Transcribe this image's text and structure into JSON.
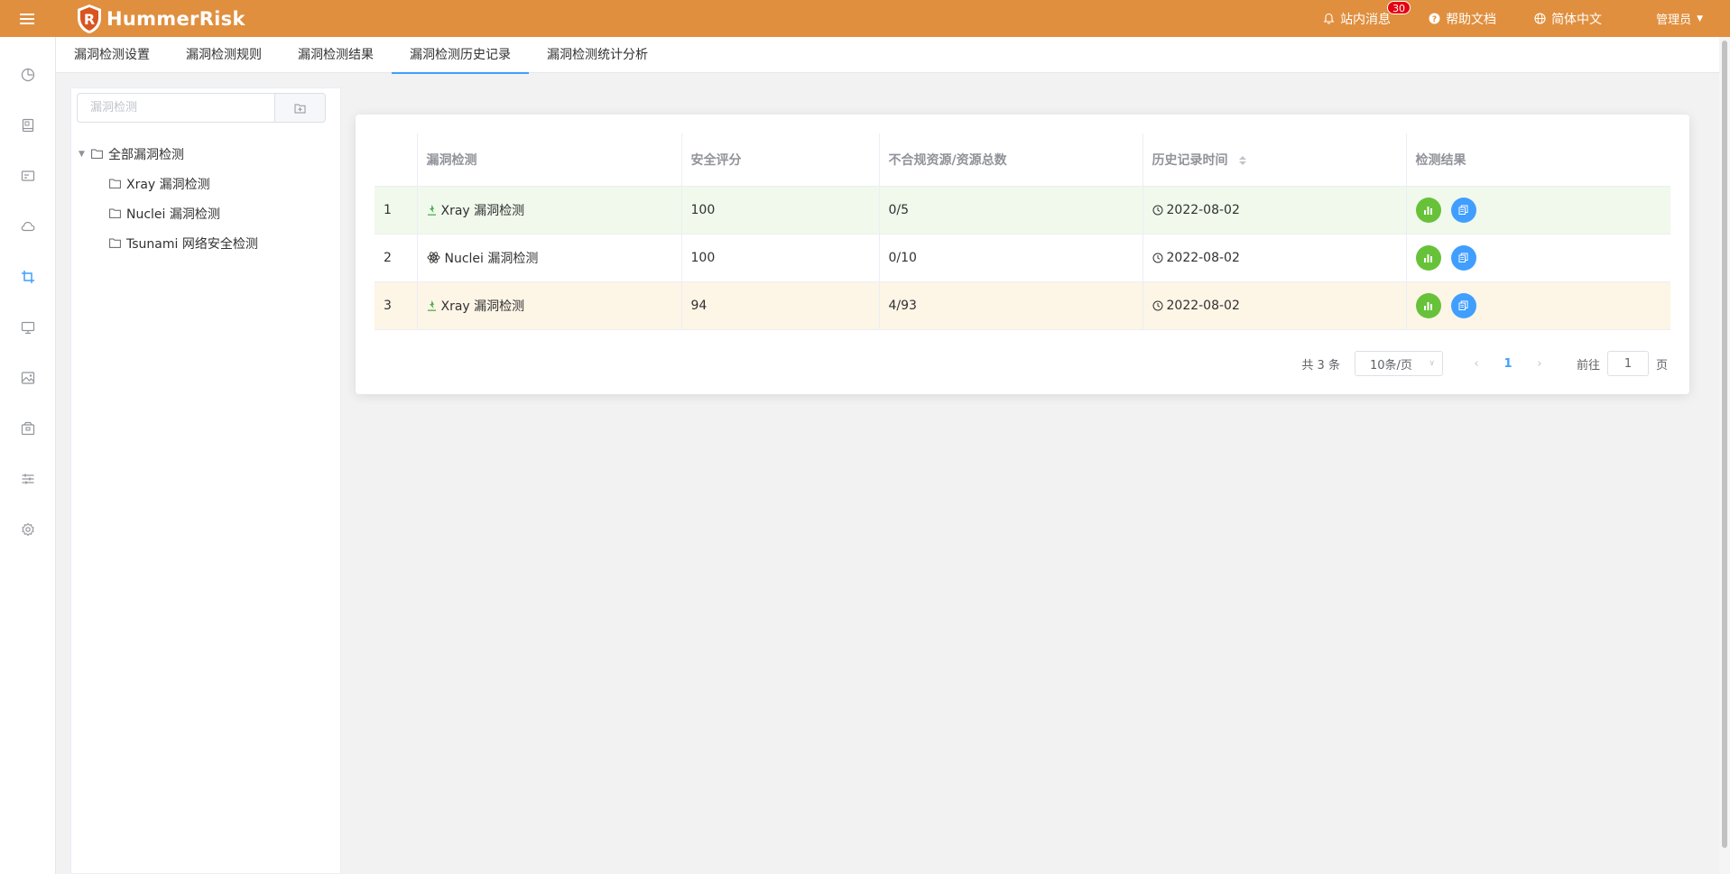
{
  "header": {
    "brand": "HummerRisk",
    "messages_label": "站内消息",
    "messages_count": "30",
    "help_label": "帮助文档",
    "language_label": "简体中文",
    "user_label": "管理员"
  },
  "sidebar": {
    "items": [
      {
        "icon": "dashboard-icon"
      },
      {
        "icon": "book-icon"
      },
      {
        "icon": "id-card-icon"
      },
      {
        "icon": "cloud-icon"
      },
      {
        "icon": "crop-icon",
        "active": true
      },
      {
        "icon": "monitor-icon"
      },
      {
        "icon": "image-icon"
      },
      {
        "icon": "package-icon"
      },
      {
        "icon": "sliders-icon"
      },
      {
        "icon": "settings-icon"
      }
    ]
  },
  "tabs": [
    {
      "label": "漏洞检测设置"
    },
    {
      "label": "漏洞检测规则"
    },
    {
      "label": "漏洞检测结果"
    },
    {
      "label": "漏洞检测历史记录",
      "active": true
    },
    {
      "label": "漏洞检测统计分析"
    }
  ],
  "tree": {
    "search_placeholder": "漏洞检测",
    "root": "全部漏洞检测",
    "children": [
      "Xray 漏洞检测",
      "Nuclei 漏洞检测",
      "Tsunami 网络安全检测"
    ]
  },
  "table": {
    "headers": {
      "name": "漏洞检测",
      "score": "安全评分",
      "ratio": "不合规资源/资源总数",
      "time": "历史记录时间",
      "result": "检测结果"
    },
    "rows": [
      {
        "index": "1",
        "name": "Xray 漏洞检测",
        "score": "100",
        "ratio": "0/5",
        "time": "2022-08-02"
      },
      {
        "index": "2",
        "name": "Nuclei 漏洞检测",
        "score": "100",
        "ratio": "0/10",
        "time": "2022-08-02"
      },
      {
        "index": "3",
        "name": "Xray 漏洞检测",
        "score": "94",
        "ratio": "4/93",
        "time": "2022-08-02"
      }
    ]
  },
  "pagination": {
    "total": "共 3 条",
    "page_size": "10条/页",
    "current_page": "1",
    "goto_prefix": "前往",
    "goto_value": "1",
    "goto_suffix": "页"
  },
  "colors": {
    "header_bg": "#e08f3e",
    "accent": "#409eff",
    "success": "#67c23a",
    "row_success_bg": "#f0f9eb",
    "row_warning_bg": "#fdf5e6"
  }
}
